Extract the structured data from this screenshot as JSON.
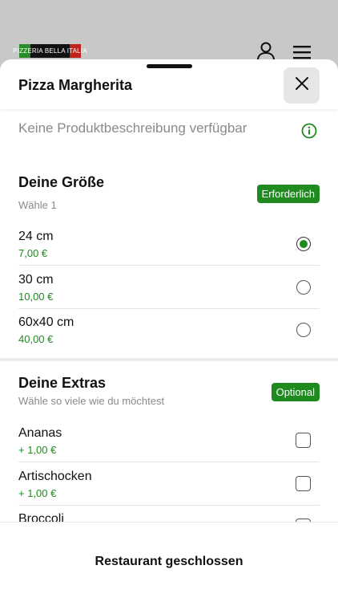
{
  "app": {
    "logo_text": "PIZZERIA BELLA ITALIA",
    "background_icons": [
      "user-icon",
      "menu-icon"
    ]
  },
  "sheet": {
    "title": "Pizza Margherita",
    "close_icon": "close-icon",
    "description": "Keine Produktbeschreibung verfügbar",
    "info_icon": "info-icon"
  },
  "size_section": {
    "title": "Deine Größe",
    "subtitle": "Wähle 1",
    "badge": "Erforderlich",
    "options": [
      {
        "name": "24 cm",
        "price": "7,00 €",
        "selected": true
      },
      {
        "name": "30 cm",
        "price": "10,00 €",
        "selected": false
      },
      {
        "name": "60x40 cm",
        "price": "40,00 €",
        "selected": false
      }
    ]
  },
  "extras_section": {
    "title": "Deine Extras",
    "subtitle": "Wähle so viele wie du möchtest",
    "badge": "Optional",
    "options": [
      {
        "name": "Ananas",
        "price": "+ 1,00 €",
        "checked": false
      },
      {
        "name": "Artischocken",
        "price": "+ 1,00 €",
        "checked": false
      },
      {
        "name": "Broccoli",
        "price": "",
        "checked": false
      }
    ]
  },
  "footer": {
    "label": "Restaurant geschlossen"
  },
  "colors": {
    "accent_green": "#1f8a1f",
    "backdrop": "#c8c8c8"
  }
}
